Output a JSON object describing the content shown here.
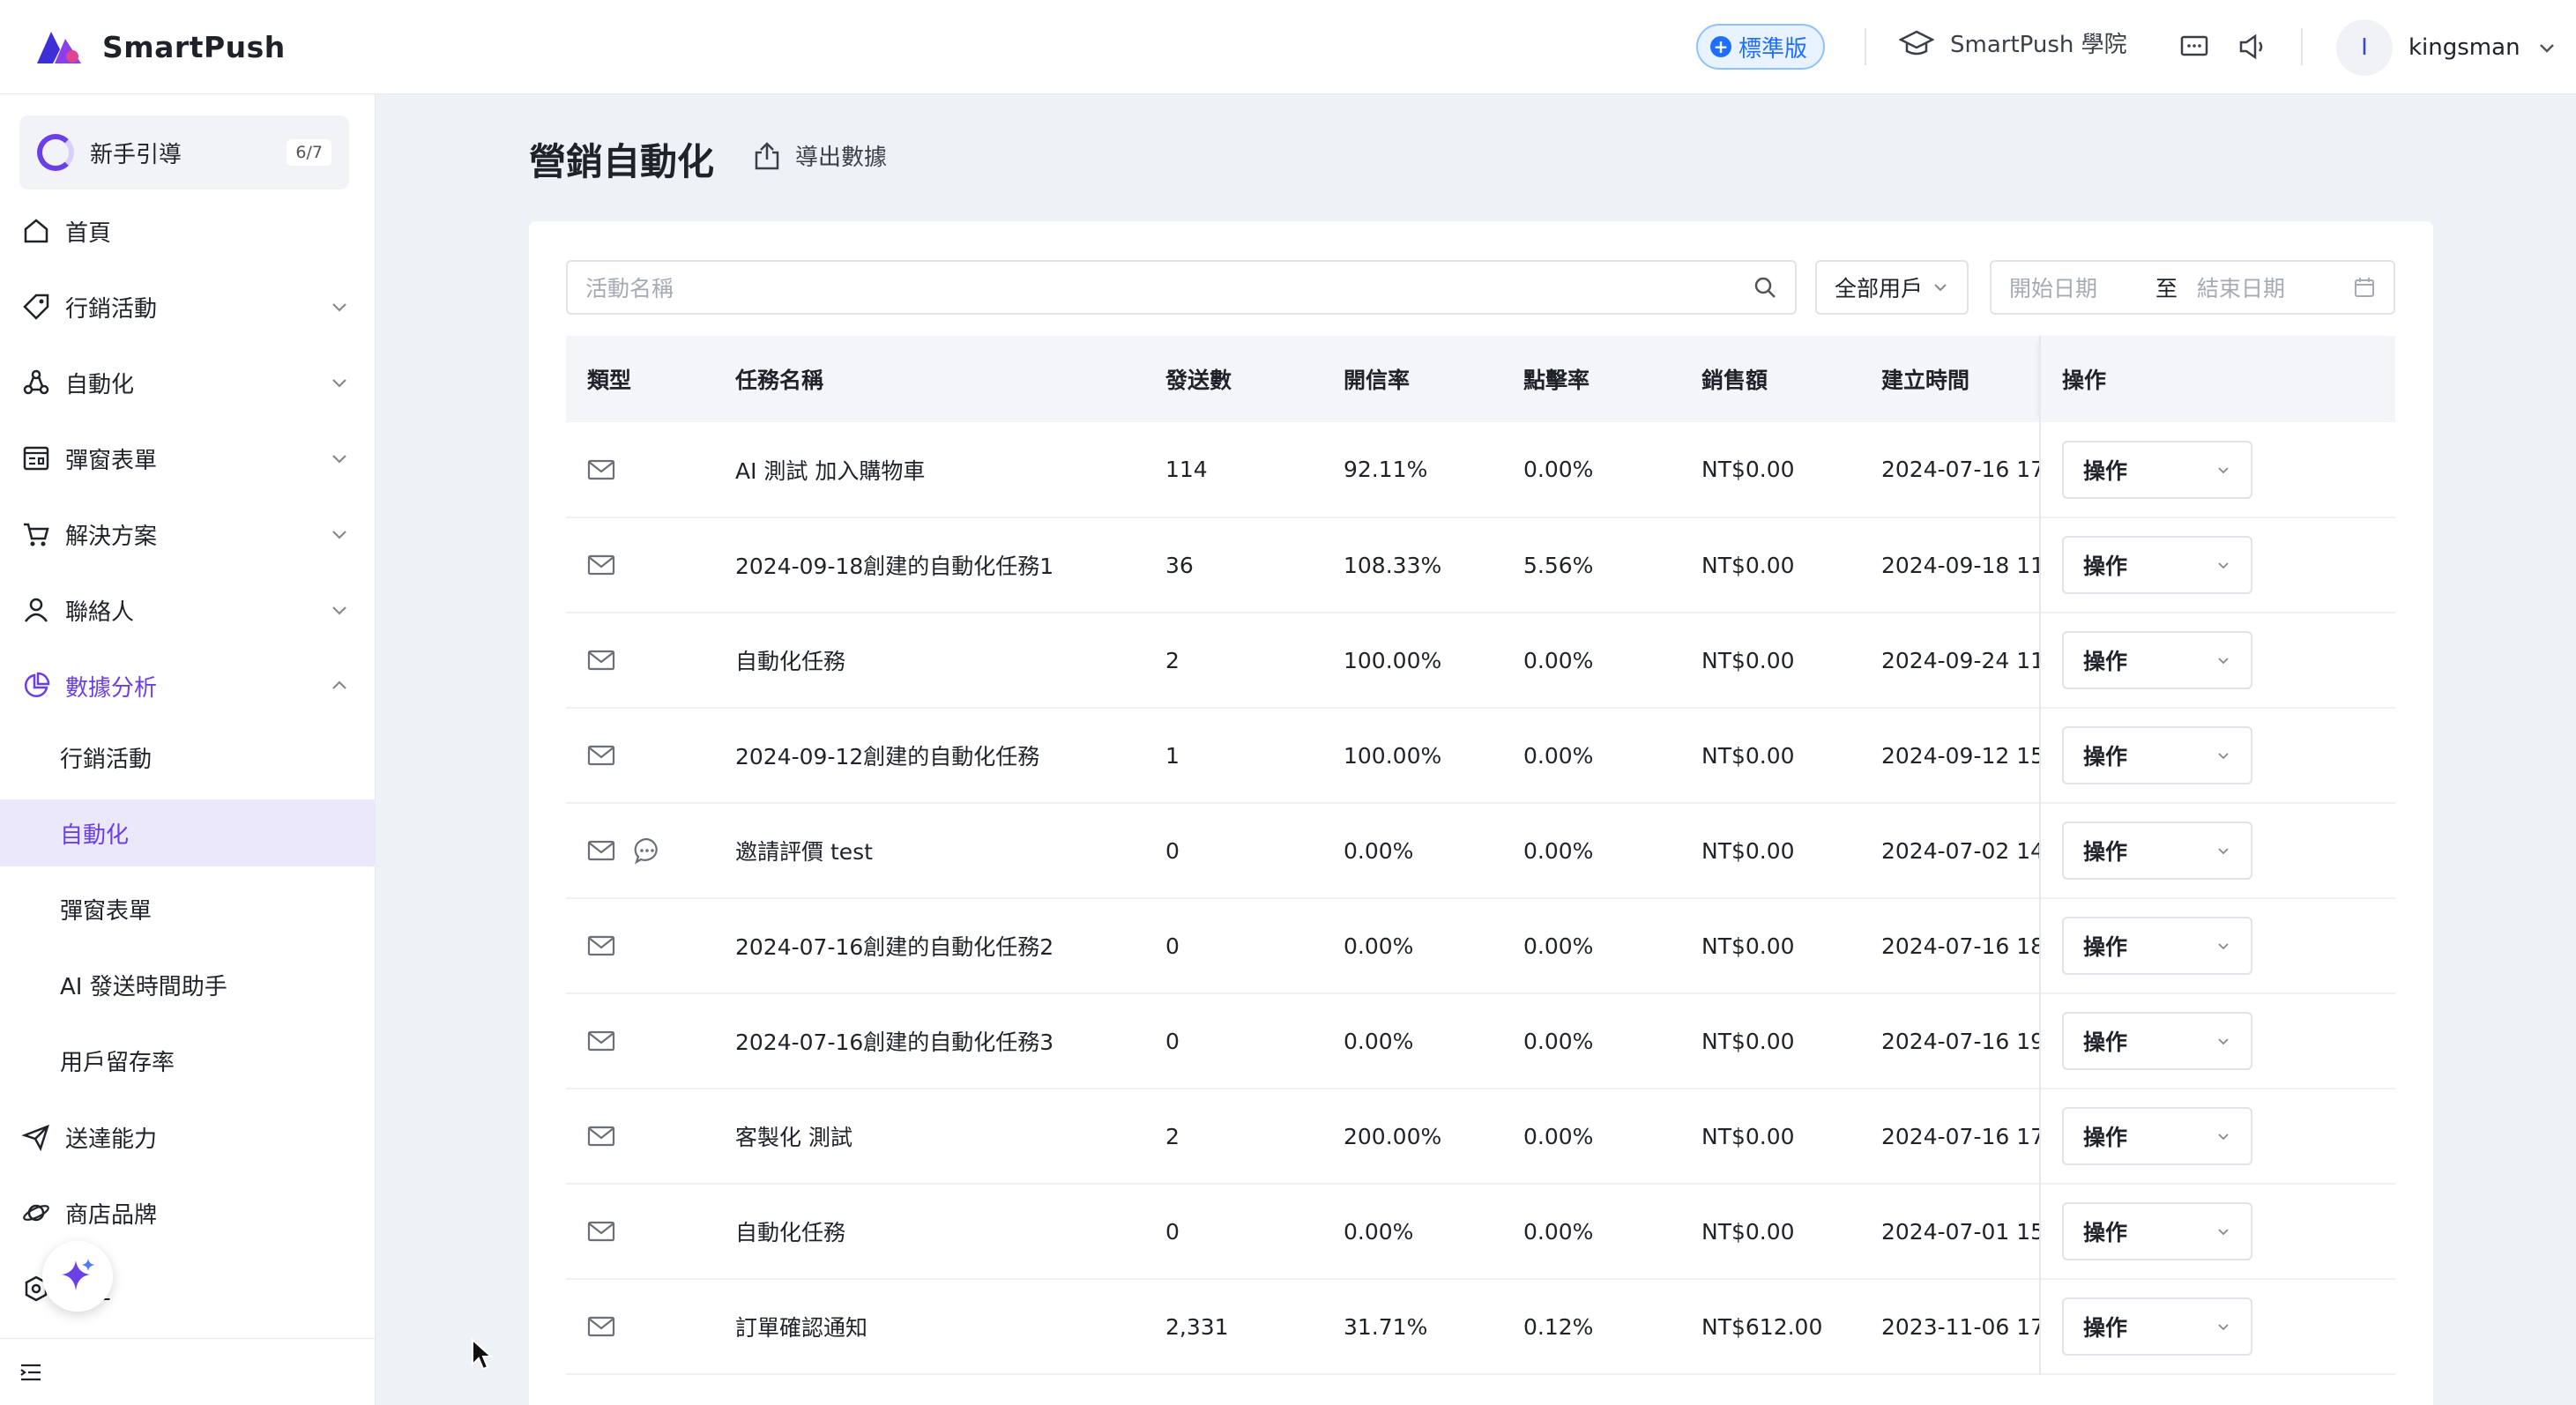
{
  "app": {
    "name": "SmartPush"
  },
  "header": {
    "plan_badge": "標準版",
    "academy": "SmartPush 學院",
    "user_initial": "I",
    "username": "kingsman"
  },
  "sidebar": {
    "guide": {
      "label": "新手引導",
      "progress": "6/7"
    },
    "items": [
      {
        "label": "首頁"
      },
      {
        "label": "行銷活動"
      },
      {
        "label": "自動化"
      },
      {
        "label": "彈窗表單"
      },
      {
        "label": "解決方案"
      },
      {
        "label": "聯絡人"
      },
      {
        "label": "數據分析"
      },
      {
        "label": "送達能力"
      },
      {
        "label": "商店品牌"
      },
      {
        "label": "設定"
      }
    ],
    "sub_items": [
      {
        "label": "行銷活動"
      },
      {
        "label": "自動化"
      },
      {
        "label": "彈窗表單"
      },
      {
        "label": "AI 發送時間助手"
      },
      {
        "label": "用戶留存率"
      }
    ],
    "active_sub": "自動化"
  },
  "page": {
    "title": "營銷自動化",
    "export_label": "導出數據"
  },
  "filters": {
    "search_placeholder": "活動名稱",
    "user_select": "全部用戶",
    "start_date_placeholder": "開始日期",
    "to_label": "至",
    "end_date_placeholder": "結束日期"
  },
  "table": {
    "columns": [
      "類型",
      "任務名稱",
      "發送數",
      "開信率",
      "點擊率",
      "銷售額",
      "建立時間",
      "操作"
    ],
    "rows": [
      {
        "types": [
          "email"
        ],
        "name": "AI 測試 加入購物車",
        "sent": "114",
        "open_rate": "92.11%",
        "click_rate": "0.00%",
        "sales": "NT$0.00",
        "created": "2024-07-16 17:",
        "action": "操作"
      },
      {
        "types": [
          "email"
        ],
        "name": "2024-09-18創建的自動化任務1",
        "sent": "36",
        "open_rate": "108.33%",
        "click_rate": "5.56%",
        "sales": "NT$0.00",
        "created": "2024-09-18 11:",
        "action": "操作"
      },
      {
        "types": [
          "email"
        ],
        "name": "自動化任務",
        "sent": "2",
        "open_rate": "100.00%",
        "click_rate": "0.00%",
        "sales": "NT$0.00",
        "created": "2024-09-24 11:",
        "action": "操作"
      },
      {
        "types": [
          "email"
        ],
        "name": "2024-09-12創建的自動化任務",
        "sent": "1",
        "open_rate": "100.00%",
        "click_rate": "0.00%",
        "sales": "NT$0.00",
        "created": "2024-09-12 15:",
        "action": "操作"
      },
      {
        "types": [
          "email",
          "sms"
        ],
        "name": "邀請評價 test",
        "sent": "0",
        "open_rate": "0.00%",
        "click_rate": "0.00%",
        "sales": "NT$0.00",
        "created": "2024-07-02 14",
        "action": "操作"
      },
      {
        "types": [
          "email"
        ],
        "name": "2024-07-16創建的自動化任務2",
        "sent": "0",
        "open_rate": "0.00%",
        "click_rate": "0.00%",
        "sales": "NT$0.00",
        "created": "2024-07-16 18:",
        "action": "操作"
      },
      {
        "types": [
          "email"
        ],
        "name": "2024-07-16創建的自動化任務3",
        "sent": "0",
        "open_rate": "0.00%",
        "click_rate": "0.00%",
        "sales": "NT$0.00",
        "created": "2024-07-16 19:",
        "action": "操作"
      },
      {
        "types": [
          "email"
        ],
        "name": "客製化 測試",
        "sent": "2",
        "open_rate": "200.00%",
        "click_rate": "0.00%",
        "sales": "NT$0.00",
        "created": "2024-07-16 17:",
        "action": "操作"
      },
      {
        "types": [
          "email"
        ],
        "name": "自動化任務",
        "sent": "0",
        "open_rate": "0.00%",
        "click_rate": "0.00%",
        "sales": "NT$0.00",
        "created": "2024-07-01 15:",
        "action": "操作"
      },
      {
        "types": [
          "email"
        ],
        "name": "訂單確認通知",
        "sent": "2,331",
        "open_rate": "31.71%",
        "click_rate": "0.12%",
        "sales": "NT$612.00",
        "created": "2023-11-06 17:",
        "action": "操作"
      }
    ]
  },
  "colors": {
    "accent": "#6a3fe8",
    "badge_blue": "#1e6fff",
    "background": "#eef1f6"
  }
}
